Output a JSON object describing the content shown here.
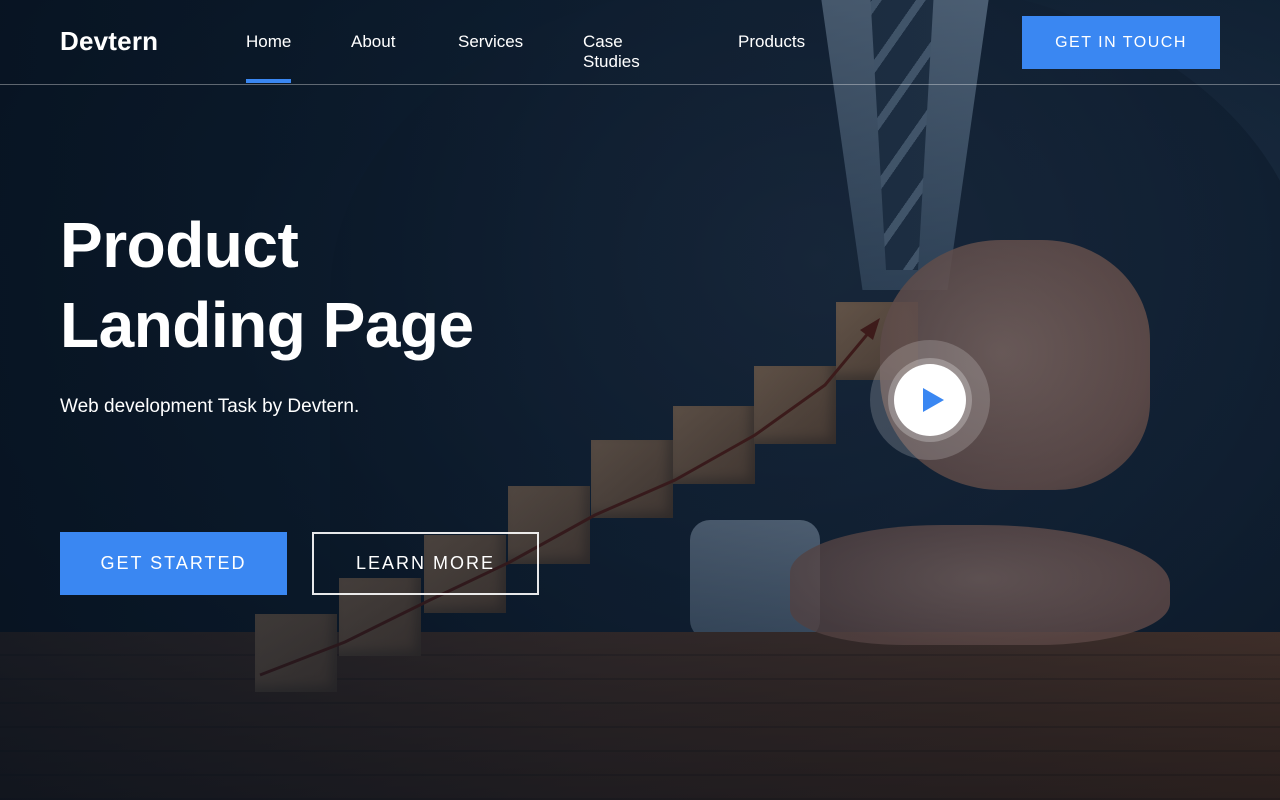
{
  "brand": {
    "name": "Devtern"
  },
  "nav": {
    "items": [
      {
        "label": "Home",
        "active": true
      },
      {
        "label": "About",
        "active": false
      },
      {
        "label": "Services",
        "active": false
      },
      {
        "label": "Case Studies",
        "active": false
      },
      {
        "label": "Products",
        "active": false
      }
    ],
    "cta_label": "GET IN TOUCH"
  },
  "hero": {
    "title_line1": "Product",
    "title_line2": "Landing Page",
    "subtitle": "Web development Task by Devtern.",
    "primary_button": "GET STARTED",
    "secondary_button": "LEARN MORE"
  },
  "video": {
    "icon": "play-icon"
  },
  "colors": {
    "accent": "#3a87f2",
    "text": "#ffffff",
    "overlay": "#0c1b2a"
  }
}
